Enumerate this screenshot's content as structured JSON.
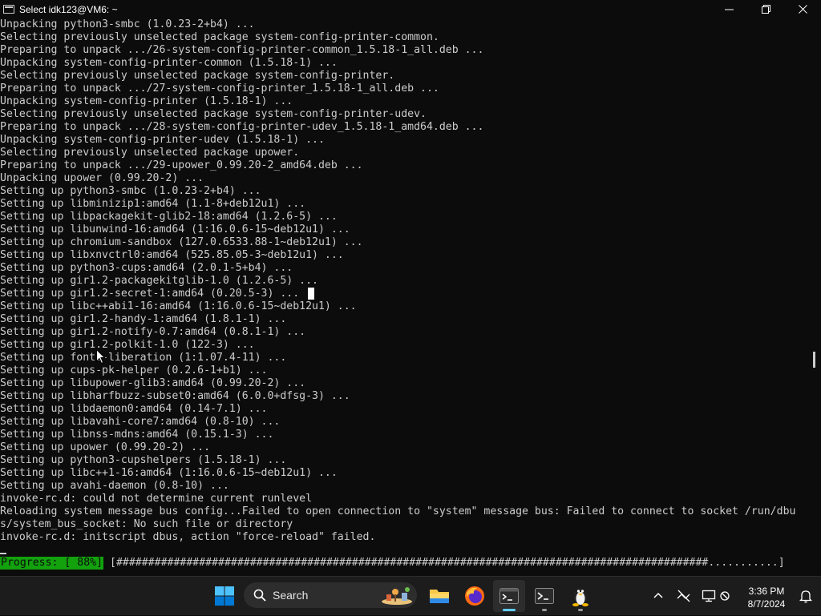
{
  "window": {
    "title": "Select idk123@VM6: ~",
    "controls": [
      "minimize-icon",
      "maximize-icon",
      "close-icon"
    ]
  },
  "terminal": {
    "lines": [
      "Unpacking python3-smbc (1.0.23-2+b4) ...",
      "Selecting previously unselected package system-config-printer-common.",
      "Preparing to unpack .../26-system-config-printer-common_1.5.18-1_all.deb ...",
      "Unpacking system-config-printer-common (1.5.18-1) ...",
      "Selecting previously unselected package system-config-printer.",
      "Preparing to unpack .../27-system-config-printer_1.5.18-1_all.deb ...",
      "Unpacking system-config-printer (1.5.18-1) ...",
      "Selecting previously unselected package system-config-printer-udev.",
      "Preparing to unpack .../28-system-config-printer-udev_1.5.18-1_amd64.deb ...",
      "Unpacking system-config-printer-udev (1.5.18-1) ...",
      "Selecting previously unselected package upower.",
      "Preparing to unpack .../29-upower_0.99.20-2_amd64.deb ...",
      "Unpacking upower (0.99.20-2) ...",
      "Setting up python3-smbc (1.0.23-2+b4) ...",
      "Setting up libminizip1:amd64 (1.1-8+deb12u1) ...",
      "Setting up libpackagekit-glib2-18:amd64 (1.2.6-5) ...",
      "Setting up libunwind-16:amd64 (1:16.0.6-15~deb12u1) ...",
      "Setting up chromium-sandbox (127.0.6533.88-1~deb12u1) ...",
      "Setting up libxnvctrl0:amd64 (525.85.05-3~deb12u1) ...",
      "Setting up python3-cups:amd64 (2.0.1-5+b4) ...",
      "Setting up gir1.2-packagekitglib-1.0 (1.2.6-5) ...",
      "Setting up gir1.2-secret-1:amd64 (0.20.5-3) ...",
      "Setting up libc++abi1-16:amd64 (1:16.0.6-15~deb12u1) ...",
      "Setting up gir1.2-handy-1:amd64 (1.8.1-1) ...",
      "Setting up gir1.2-notify-0.7:amd64 (0.8.1-1) ...",
      "Setting up gir1.2-polkit-1.0 (122-3) ...",
      "Setting up fonts-liberation (1:1.07.4-11) ...",
      "Setting up cups-pk-helper (0.2.6-1+b1) ...",
      "Setting up libupower-glib3:amd64 (0.99.20-2) ...",
      "Setting up libharfbuzz-subset0:amd64 (6.0.0+dfsg-3) ...",
      "Setting up libdaemon0:amd64 (0.14-7.1) ...",
      "Setting up libavahi-core7:amd64 (0.8-10) ...",
      "Setting up libnss-mdns:amd64 (0.15.1-3) ...",
      "Setting up upower (0.99.20-2) ...",
      "Setting up python3-cupshelpers (1.5.18-1) ...",
      "Setting up libc++1-16:amd64 (1:16.0.6-15~deb12u1) ...",
      "Setting up avahi-daemon (0.8-10) ...",
      "invoke-rc.d: could not determine current runlevel",
      "Reloading system message bus config...Failed to open connection to \"system\" message bus: Failed to connect to socket /run/dbu",
      "s/system_bus_socket: No such file or directory",
      "invoke-rc.d: initscript dbus, action \"force-reload\" failed."
    ],
    "progress": {
      "label": "Progress: [ 88%]",
      "percent": 88,
      "bar": "[#############################################################################################...........]"
    }
  },
  "taskbar": {
    "search_label": "Search",
    "apps": [
      "windows-start-icon",
      "search-icon",
      "file-explorer-icon",
      "firefox-icon",
      "terminal-icon",
      "powershell-icon",
      "linux-tux-icon"
    ],
    "tray": {
      "icons": [
        "chevron-up-icon",
        "network-off-icon",
        "display-icon",
        "settings-icon",
        "notification-bell-icon"
      ],
      "time": "3:36 PM",
      "date": "8/7/2024"
    }
  },
  "colors": {
    "terminal_bg": "#0c0c0c",
    "terminal_fg": "#cccccc",
    "progress_green": "#13a10e",
    "taskbar_bg": "#1c1c1c",
    "accent": "#60cdff"
  }
}
